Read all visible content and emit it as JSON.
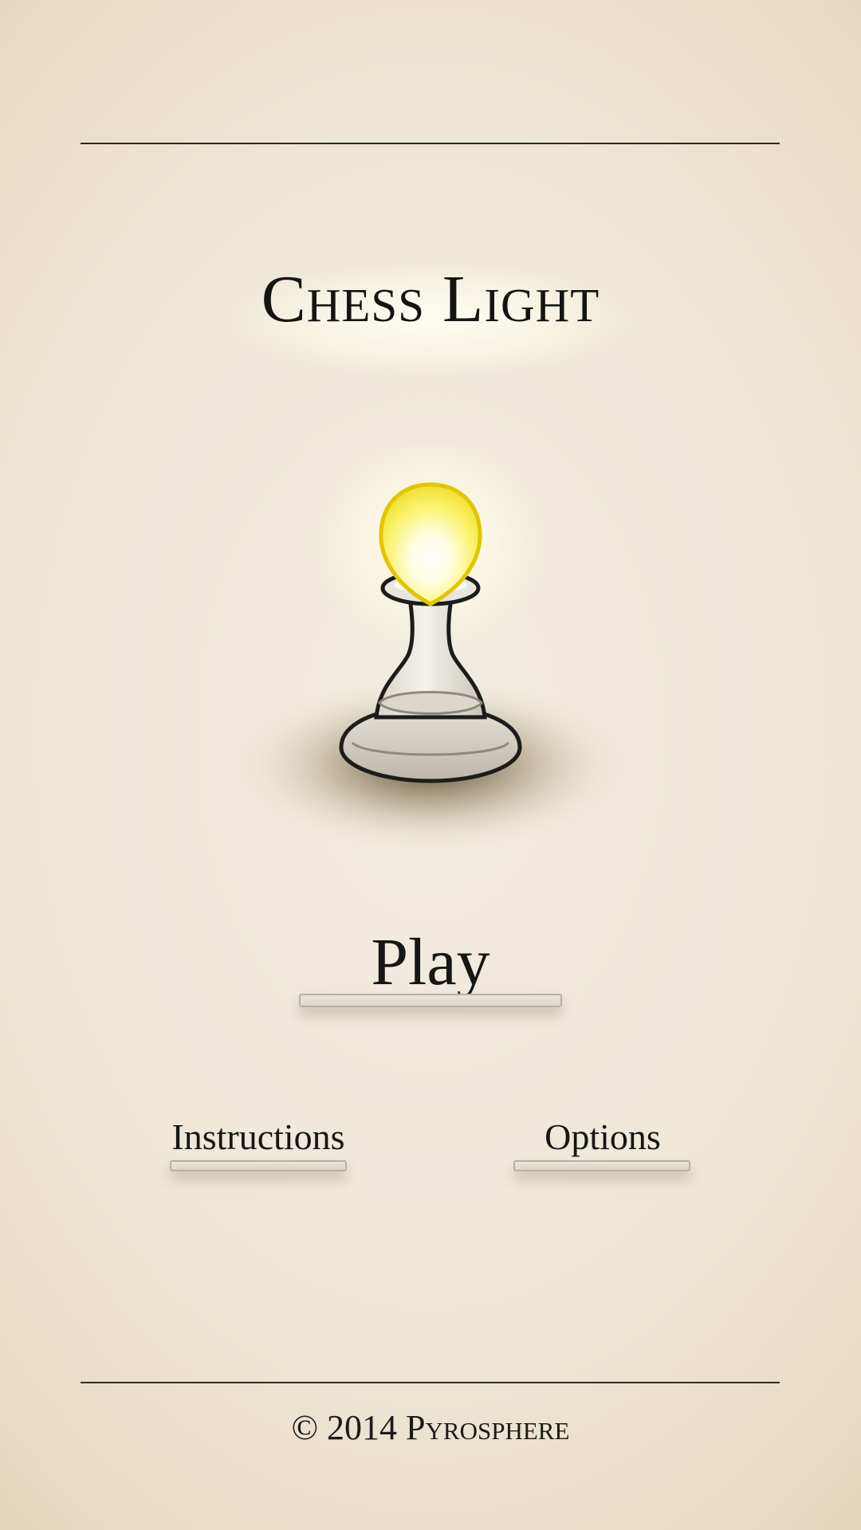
{
  "app": {
    "title": "Chess Light"
  },
  "menu": {
    "play_label": "Play",
    "instructions_label": "Instructions",
    "options_label": "Options"
  },
  "footer": {
    "copyright_symbol": "©",
    "year": "2014",
    "company": "Pyrosphere"
  },
  "icons": {
    "hero": "glowing-pawn-icon"
  },
  "colors": {
    "background": "#efe7d8",
    "text": "#161616",
    "rule": "#2a2a2a",
    "bulb": "#f6e840",
    "bulb_outline": "#e2c400"
  }
}
